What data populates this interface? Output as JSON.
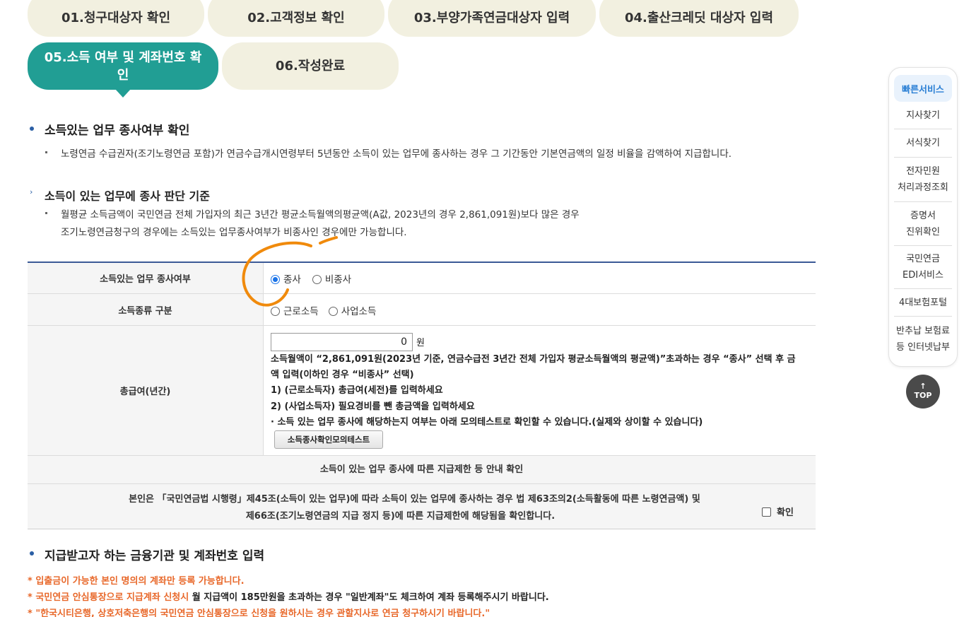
{
  "steps": [
    {
      "label": "01.청구대상자 확인"
    },
    {
      "label": "02.고객정보 확인"
    },
    {
      "label": "03.부양가족연금대상자 입력"
    },
    {
      "label": "04.출산크레딧 대상자 입력"
    },
    {
      "label": "05.소득 여부 및 계좌번호 확인",
      "active": true
    },
    {
      "label": "06.작성완료"
    }
  ],
  "section1": {
    "title": "소득있는 업무 종사여부 확인",
    "desc": "노령연금 수급권자(조기노령연금 포함)가 연금수급개시연령부터 5년동안 소득이 있는 업무에 종사하는 경우 그 기간동안 기본연금액의 일정 비율을 감액하여 지급합니다."
  },
  "section2": {
    "title": "소득이 있는 업무에 종사 판단 기준",
    "line1": "월평균 소득금액이 국민연금 전체 가입자의 최근 3년간 평균소득월액의평균액(A값, 2023년의 경우 2,861,091원)보다 많은 경우",
    "line2": "조기노령연금청구의 경우에는 소득있는 업무종사여부가 비종사인 경우에만 가능합니다."
  },
  "form": {
    "employment": {
      "label": "소득있는 업무 종사여부",
      "options": [
        "종사",
        "비종사"
      ],
      "selected": "종사"
    },
    "income_type": {
      "label": "소득종류 구분",
      "options": [
        "근로소득",
        "사업소득"
      ],
      "selected": ""
    },
    "salary": {
      "label": "총급여(년간)",
      "value": "0",
      "unit": "원",
      "desc1": "소득월액이 “2,861,091원(2023년 기준, 연금수급전 3년간 전체 가입자 평균소득월액의 평균액)”초과하는 경우 “종사” 선택 후 금",
      "desc2": "액 입력(이하인 경우 “비종사” 선택)",
      "desc3": "1) (근로소득자) 총급여(세전)를 입력하세요",
      "desc4": "2) (사업소득자) 필요경비를 뺀 총금액을 입력하세요",
      "desc5": "· 소득 있는 업무 종사에 해당하는지 여부는 아래 모의테스트로 확인할 수 있습니다.(실제와 상이할 수 있습니다)",
      "button": "소득종사확인모의테스트"
    },
    "notice": {
      "title": "소득이 있는 업무 종사에 따른 지급제한 등 안내 확인",
      "line1": "본인은 「국민연금법 시행령」제45조(소득이 있는 업무)에 따라 소득이 있는 업무에 종사하는 경우 법 제63조의2(소득활동에 따른 노령연금액) 및",
      "line2": "제66조(조기노령연금의 지급 정지 등)에 따른 지급제한에 해당됨을 확인합니다.",
      "confirm": "확인",
      "checked": false
    }
  },
  "section3": {
    "title": "지급받고자 하는 금융기관 및 계좌번호 입력",
    "note1": "* 입출금이 가능한 본인 명의의 계좌만 등록 가능합니다.",
    "note2_red": "* 국민연금 안심통장으로 지급계좌 신청시",
    "note2_black": " 월 지급액이 185만원을 초과하는 경우 \"일반계좌\"도 체크하여 계좌 등록해주시기 바랍니다.",
    "note3": "* \"한국시티은행, 상호저축은행의 국민연금 안심통장으로 신청을 원하시는 경우 관할지사로 연금 청구하시기 바랍니다.\""
  },
  "quick_menu": {
    "title": "빠른서비스",
    "items": [
      {
        "l1": "지사찾기",
        "l2": ""
      },
      {
        "l1": "서식찾기",
        "l2": ""
      },
      {
        "l1": "전자민원",
        "l2": "처리과정조회"
      },
      {
        "l1": "증명서",
        "l2": "진위확인"
      },
      {
        "l1": "국민연금",
        "l2": "EDI서비스"
      },
      {
        "l1": "4대보험포털",
        "l2": ""
      },
      {
        "l1": "반추납 보험료",
        "l2": "등 인터넷납부"
      }
    ]
  },
  "top_button": {
    "arrow": "↑",
    "label": "TOP"
  },
  "colors": {
    "accent": "#219e94",
    "tab_bg": "#f2f0e0",
    "table_border": "#3b5996",
    "warn": "#e8682a",
    "annotation": "#f08a0c",
    "quick_accent": "#2a7fd4"
  }
}
